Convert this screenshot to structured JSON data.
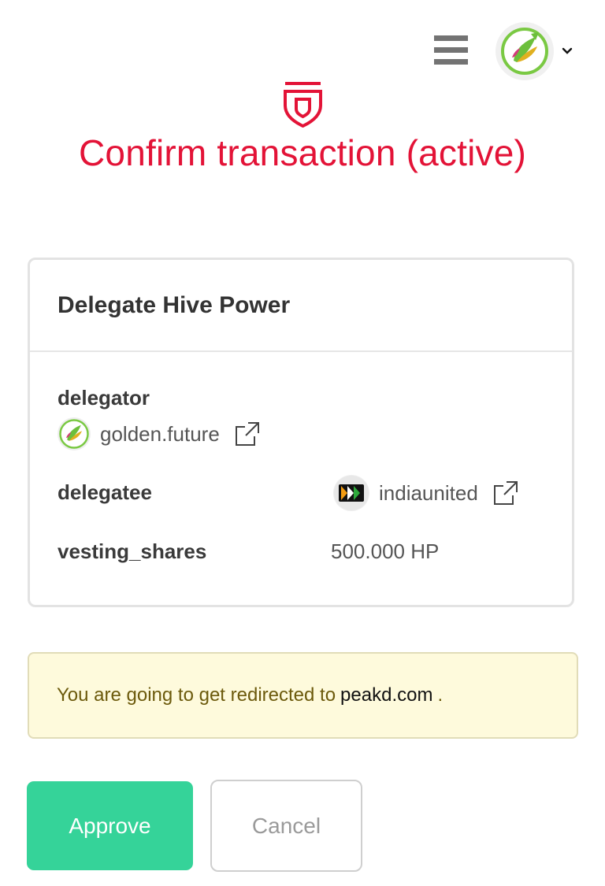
{
  "header": {
    "menu_icon": "hamburger-menu-icon",
    "avatar_icon": "user-avatar",
    "dropdown_icon": "chevron-down-icon"
  },
  "page": {
    "icon": "shield-icon",
    "title": "Confirm transaction (active)",
    "accent_color": "#e31337"
  },
  "operation": {
    "title": "Delegate Hive Power",
    "fields": [
      {
        "label": "delegator",
        "value": "golden.future",
        "has_avatar": true,
        "has_link": true
      },
      {
        "label": "delegatee",
        "value": "indiaunited",
        "has_avatar": true,
        "has_link": true
      },
      {
        "label": "vesting_shares",
        "value": "500.000 HP"
      }
    ]
  },
  "notice": {
    "text": "You are going to get redirected to",
    "domain": "peakd.com",
    "suffix": "."
  },
  "actions": {
    "approve_label": "Approve",
    "cancel_label": "Cancel",
    "approve_color": "#35d399"
  }
}
